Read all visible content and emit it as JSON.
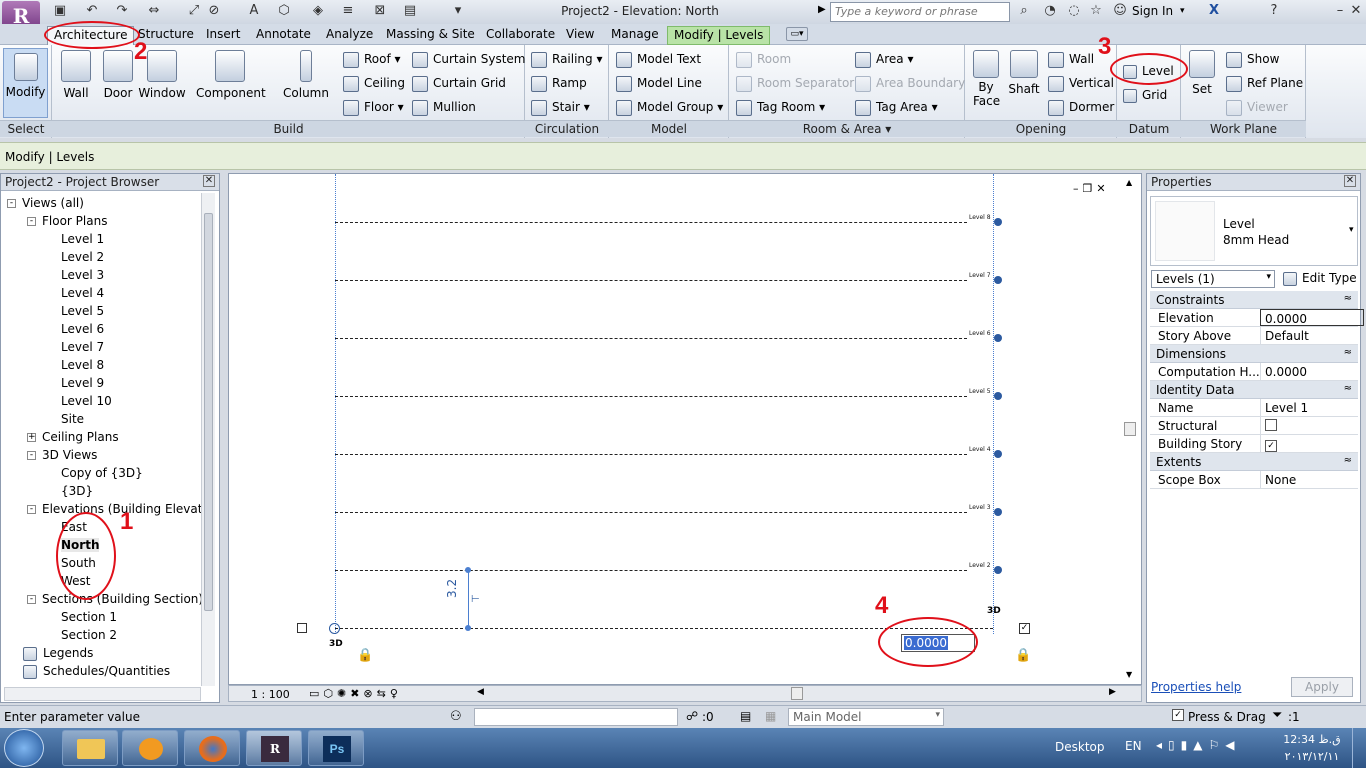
{
  "window": {
    "title": "Project2 - Elevation: North",
    "app_letter": "R",
    "search_placeholder": "Type a keyword or phrase",
    "sign_in": "Sign In"
  },
  "tabs": [
    "Architecture",
    "Structure",
    "Insert",
    "Annotate",
    "Analyze",
    "Massing & Site",
    "Collaborate",
    "View",
    "Manage",
    "Modify | Levels"
  ],
  "ribbon": {
    "select": {
      "modify": "Modify",
      "label": "Select"
    },
    "build": {
      "label": "Build",
      "wall": "Wall",
      "door": "Door",
      "window": "Window",
      "component": "Component",
      "column": "Column",
      "roof": "Roof",
      "ceiling": "Ceiling",
      "floor": "Floor",
      "curtain_system": "Curtain System",
      "curtain_grid": "Curtain Grid",
      "mullion": "Mullion"
    },
    "circulation": {
      "label": "Circulation",
      "railing": "Railing",
      "ramp": "Ramp",
      "stair": "Stair"
    },
    "model": {
      "label": "Model",
      "model_text": "Model Text",
      "model_line": "Model Line",
      "model_group": "Model Group"
    },
    "room_area": {
      "label": "Room & Area",
      "room": "Room",
      "room_separator": "Room Separator",
      "tag_room": "Tag Room",
      "area": "Area",
      "area_boundary": "Area Boundary",
      "tag_area": "Tag Area"
    },
    "opening": {
      "label": "Opening",
      "by_face": "By Face",
      "shaft": "Shaft",
      "wall": "Wall",
      "vertical": "Vertical",
      "dormer": "Dormer"
    },
    "datum": {
      "label": "Datum",
      "level": "Level",
      "grid": "Grid"
    },
    "work_plane": {
      "label": "Work Plane",
      "set": "Set",
      "show": "Show",
      "ref_plane": "Ref Plane",
      "viewer": "Viewer"
    }
  },
  "options_bar": "Modify | Levels",
  "browser": {
    "title": "Project2 - Project Browser",
    "items": [
      {
        "text": "Views (all)",
        "indent": 0,
        "tog": "-"
      },
      {
        "text": "Floor Plans",
        "indent": 1,
        "tog": "-"
      },
      {
        "text": "Level 1",
        "indent": 2
      },
      {
        "text": "Level 2",
        "indent": 2
      },
      {
        "text": "Level 3",
        "indent": 2
      },
      {
        "text": "Level 4",
        "indent": 2
      },
      {
        "text": "Level 5",
        "indent": 2
      },
      {
        "text": "Level 6",
        "indent": 2
      },
      {
        "text": "Level 7",
        "indent": 2
      },
      {
        "text": "Level 8",
        "indent": 2
      },
      {
        "text": "Level 9",
        "indent": 2
      },
      {
        "text": "Level 10",
        "indent": 2
      },
      {
        "text": "Site",
        "indent": 2
      },
      {
        "text": "Ceiling Plans",
        "indent": 1,
        "tog": "+"
      },
      {
        "text": "3D Views",
        "indent": 1,
        "tog": "-"
      },
      {
        "text": "Copy of {3D}",
        "indent": 2
      },
      {
        "text": "{3D}",
        "indent": 2
      },
      {
        "text": "Elevations (Building Elevatio",
        "indent": 1,
        "tog": "-"
      },
      {
        "text": "East",
        "indent": 2
      },
      {
        "text": "North",
        "indent": 2,
        "bold": true
      },
      {
        "text": "South",
        "indent": 2
      },
      {
        "text": "West",
        "indent": 2
      },
      {
        "text": "Sections (Building Section)",
        "indent": 1,
        "tog": "-"
      },
      {
        "text": "Section 1",
        "indent": 2
      },
      {
        "text": "Section 2",
        "indent": 2
      },
      {
        "text": "Legends",
        "indent": 0
      },
      {
        "text": "Schedules/Quantities",
        "indent": 0
      }
    ]
  },
  "drawing": {
    "levels": [
      "Level 8",
      "Level 7",
      "Level 6",
      "Level 5",
      "Level 4",
      "Level 3",
      "Level 2"
    ],
    "dimension": "3.2",
    "edit_value": "0.0000",
    "label_3d": "3D",
    "scale": "1 : 100"
  },
  "properties": {
    "title": "Properties",
    "type_name": "Level",
    "type_sub": "8mm Head",
    "selector": "Levels (1)",
    "edit_type": "Edit Type",
    "groups": [
      {
        "name": "Constraints",
        "rows": [
          {
            "k": "Elevation",
            "v": "0.0000"
          },
          {
            "k": "Story Above",
            "v": "Default"
          }
        ]
      },
      {
        "name": "Dimensions",
        "rows": [
          {
            "k": "Computation H...",
            "v": "0.0000"
          }
        ]
      },
      {
        "name": "Identity Data",
        "rows": [
          {
            "k": "Name",
            "v": "Level 1"
          },
          {
            "k": "Structural",
            "v": ""
          },
          {
            "k": "Building Story",
            "v": "✓"
          }
        ]
      },
      {
        "name": "Extents",
        "rows": [
          {
            "k": "Scope Box",
            "v": "None"
          }
        ]
      }
    ],
    "help": "Properties help",
    "apply": "Apply"
  },
  "status": {
    "hint": "Enter parameter value",
    "selection_count": ":0",
    "model": "Main Model",
    "press_drag": "Press & Drag",
    "filter_count": ":1"
  },
  "taskbar": {
    "desktop": "Desktop",
    "lang": "EN",
    "time": "12:34 ق.ظ",
    "date": "٢٠١٣/١٢/١١"
  },
  "annotations": [
    "1",
    "2",
    "3",
    "4"
  ],
  "colors": {
    "annotation": "#e0101a",
    "contextual_tab": "#b9e3a7",
    "level_head": "#2c5aa0"
  }
}
